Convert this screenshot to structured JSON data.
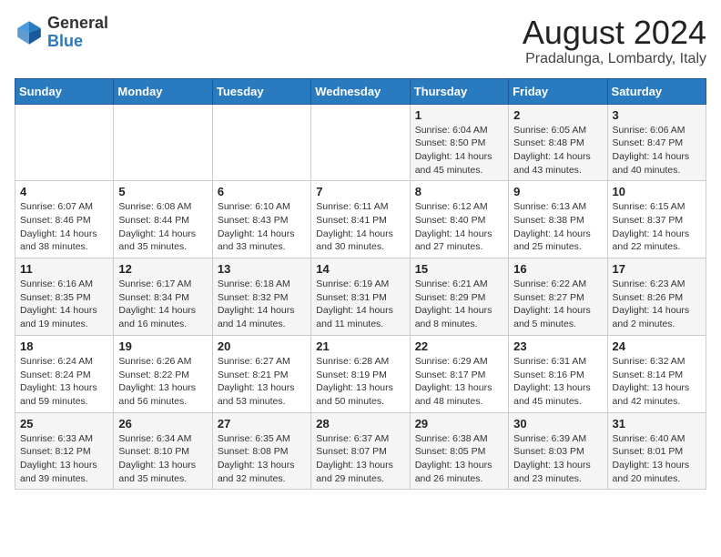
{
  "logo": {
    "general": "General",
    "blue": "Blue"
  },
  "title": "August 2024",
  "subtitle": "Pradalunga, Lombardy, Italy",
  "weekdays": [
    "Sunday",
    "Monday",
    "Tuesday",
    "Wednesday",
    "Thursday",
    "Friday",
    "Saturday"
  ],
  "weeks": [
    [
      {
        "day": "",
        "info": ""
      },
      {
        "day": "",
        "info": ""
      },
      {
        "day": "",
        "info": ""
      },
      {
        "day": "",
        "info": ""
      },
      {
        "day": "1",
        "info": "Sunrise: 6:04 AM\nSunset: 8:50 PM\nDaylight: 14 hours and 45 minutes."
      },
      {
        "day": "2",
        "info": "Sunrise: 6:05 AM\nSunset: 8:48 PM\nDaylight: 14 hours and 43 minutes."
      },
      {
        "day": "3",
        "info": "Sunrise: 6:06 AM\nSunset: 8:47 PM\nDaylight: 14 hours and 40 minutes."
      }
    ],
    [
      {
        "day": "4",
        "info": "Sunrise: 6:07 AM\nSunset: 8:46 PM\nDaylight: 14 hours and 38 minutes."
      },
      {
        "day": "5",
        "info": "Sunrise: 6:08 AM\nSunset: 8:44 PM\nDaylight: 14 hours and 35 minutes."
      },
      {
        "day": "6",
        "info": "Sunrise: 6:10 AM\nSunset: 8:43 PM\nDaylight: 14 hours and 33 minutes."
      },
      {
        "day": "7",
        "info": "Sunrise: 6:11 AM\nSunset: 8:41 PM\nDaylight: 14 hours and 30 minutes."
      },
      {
        "day": "8",
        "info": "Sunrise: 6:12 AM\nSunset: 8:40 PM\nDaylight: 14 hours and 27 minutes."
      },
      {
        "day": "9",
        "info": "Sunrise: 6:13 AM\nSunset: 8:38 PM\nDaylight: 14 hours and 25 minutes."
      },
      {
        "day": "10",
        "info": "Sunrise: 6:15 AM\nSunset: 8:37 PM\nDaylight: 14 hours and 22 minutes."
      }
    ],
    [
      {
        "day": "11",
        "info": "Sunrise: 6:16 AM\nSunset: 8:35 PM\nDaylight: 14 hours and 19 minutes."
      },
      {
        "day": "12",
        "info": "Sunrise: 6:17 AM\nSunset: 8:34 PM\nDaylight: 14 hours and 16 minutes."
      },
      {
        "day": "13",
        "info": "Sunrise: 6:18 AM\nSunset: 8:32 PM\nDaylight: 14 hours and 14 minutes."
      },
      {
        "day": "14",
        "info": "Sunrise: 6:19 AM\nSunset: 8:31 PM\nDaylight: 14 hours and 11 minutes."
      },
      {
        "day": "15",
        "info": "Sunrise: 6:21 AM\nSunset: 8:29 PM\nDaylight: 14 hours and 8 minutes."
      },
      {
        "day": "16",
        "info": "Sunrise: 6:22 AM\nSunset: 8:27 PM\nDaylight: 14 hours and 5 minutes."
      },
      {
        "day": "17",
        "info": "Sunrise: 6:23 AM\nSunset: 8:26 PM\nDaylight: 14 hours and 2 minutes."
      }
    ],
    [
      {
        "day": "18",
        "info": "Sunrise: 6:24 AM\nSunset: 8:24 PM\nDaylight: 13 hours and 59 minutes."
      },
      {
        "day": "19",
        "info": "Sunrise: 6:26 AM\nSunset: 8:22 PM\nDaylight: 13 hours and 56 minutes."
      },
      {
        "day": "20",
        "info": "Sunrise: 6:27 AM\nSunset: 8:21 PM\nDaylight: 13 hours and 53 minutes."
      },
      {
        "day": "21",
        "info": "Sunrise: 6:28 AM\nSunset: 8:19 PM\nDaylight: 13 hours and 50 minutes."
      },
      {
        "day": "22",
        "info": "Sunrise: 6:29 AM\nSunset: 8:17 PM\nDaylight: 13 hours and 48 minutes."
      },
      {
        "day": "23",
        "info": "Sunrise: 6:31 AM\nSunset: 8:16 PM\nDaylight: 13 hours and 45 minutes."
      },
      {
        "day": "24",
        "info": "Sunrise: 6:32 AM\nSunset: 8:14 PM\nDaylight: 13 hours and 42 minutes."
      }
    ],
    [
      {
        "day": "25",
        "info": "Sunrise: 6:33 AM\nSunset: 8:12 PM\nDaylight: 13 hours and 39 minutes."
      },
      {
        "day": "26",
        "info": "Sunrise: 6:34 AM\nSunset: 8:10 PM\nDaylight: 13 hours and 35 minutes."
      },
      {
        "day": "27",
        "info": "Sunrise: 6:35 AM\nSunset: 8:08 PM\nDaylight: 13 hours and 32 minutes."
      },
      {
        "day": "28",
        "info": "Sunrise: 6:37 AM\nSunset: 8:07 PM\nDaylight: 13 hours and 29 minutes."
      },
      {
        "day": "29",
        "info": "Sunrise: 6:38 AM\nSunset: 8:05 PM\nDaylight: 13 hours and 26 minutes."
      },
      {
        "day": "30",
        "info": "Sunrise: 6:39 AM\nSunset: 8:03 PM\nDaylight: 13 hours and 23 minutes."
      },
      {
        "day": "31",
        "info": "Sunrise: 6:40 AM\nSunset: 8:01 PM\nDaylight: 13 hours and 20 minutes."
      }
    ]
  ]
}
